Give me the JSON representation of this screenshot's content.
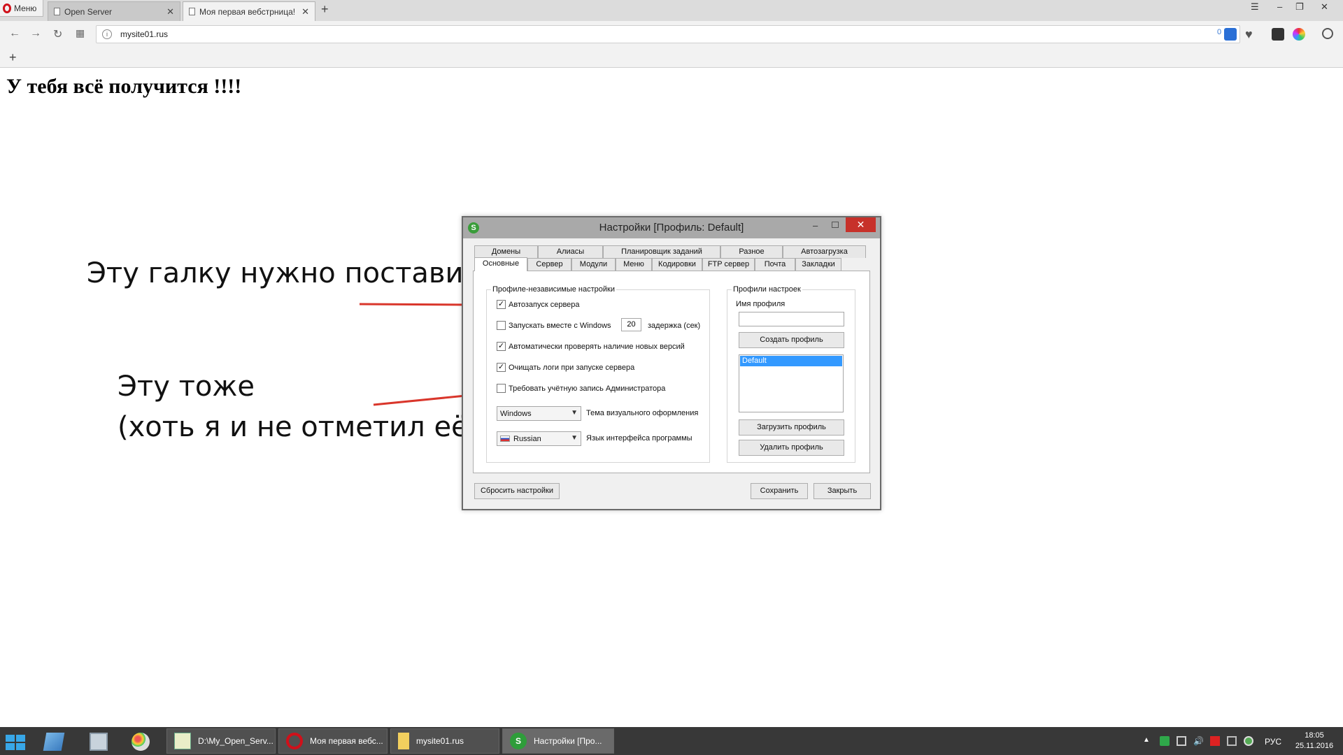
{
  "browser": {
    "menu_label": "Меню",
    "tabs": [
      {
        "title": "Open Server"
      },
      {
        "title": "Моя первая вебстрница!"
      }
    ],
    "address": "mysite01.rus",
    "badge_count": "0",
    "new_tab_glyph": "+",
    "bookmark_add_glyph": "+"
  },
  "page": {
    "heading": "У тебя всё получится !!!!",
    "annotation_1": "Эту галку нужно поставить",
    "annotation_2_line1": "Эту тоже",
    "annotation_2_line2": "(хоть я и не отметил её)",
    "arrow_color": "#d9362b"
  },
  "dialog": {
    "title": "Настройки [Профиль: Default]",
    "tabs_row1": [
      "Домены",
      "Алиасы",
      "Планировщик заданий",
      "Разное",
      "Автозагрузка"
    ],
    "tabs_row2": [
      "Основные",
      "Сервер",
      "Модули",
      "Меню",
      "Кодировки",
      "FTP сервер",
      "Почта",
      "Закладки"
    ],
    "active_tab": "Основные",
    "group_main": "Профиле-независимые настройки",
    "checks": [
      {
        "label": "Автозапуск сервера",
        "checked": true
      },
      {
        "label": "Запускать вместе с Windows",
        "checked": false
      },
      {
        "label": "Автоматически проверять наличие новых версий",
        "checked": true
      },
      {
        "label": "Очищать логи при запуске сервера",
        "checked": true
      },
      {
        "label": "Требовать учётную запись Администратора",
        "checked": false
      }
    ],
    "check_mark": "✓",
    "delay_value": "20",
    "delay_label": "задержка (сек)",
    "theme_value": "Windows",
    "theme_label": "Тема визуального оформления",
    "language_value": "Russian",
    "language_label": "Язык интерфейса программы",
    "group_profiles": "Профили настроек",
    "profile_name_label": "Имя профиля",
    "profile_name_value": "",
    "create_profile": "Создать профиль",
    "profiles_list": [
      "Default"
    ],
    "load_profile": "Загрузить профиль",
    "delete_profile": "Удалить профиль",
    "reset_button": "Сбросить настройки",
    "save_button": "Сохранить",
    "close_button": "Закрыть"
  },
  "taskbar": {
    "items": [
      {
        "label": "D:\\My_Open_Serv..."
      },
      {
        "label": "Моя первая вебс..."
      },
      {
        "label": "mysite01.rus"
      },
      {
        "label": "Настройки [Про..."
      }
    ],
    "language": "РУС",
    "time": "18:05",
    "date": "25.11.2016"
  }
}
